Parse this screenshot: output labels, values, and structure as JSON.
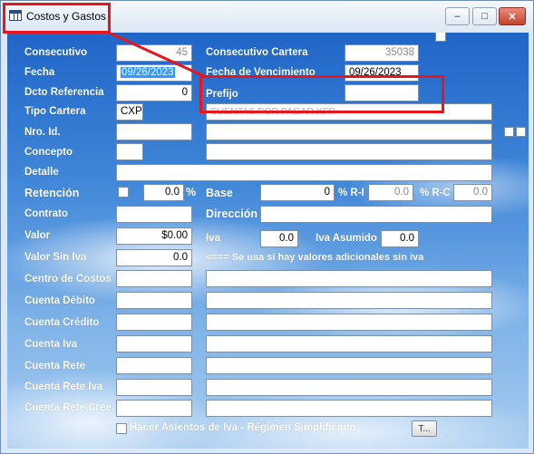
{
  "window": {
    "title": "Costos y Gastos",
    "minimize_glyph": "–",
    "maximize_glyph": "□",
    "close_glyph": "✕"
  },
  "form": {
    "consecutivo": {
      "label": "Consecutivo",
      "value": "45"
    },
    "consecutivo_cartera": {
      "label": "Consecutivo Cartera",
      "value": "35038"
    },
    "fecha": {
      "label": "Fecha",
      "value": "09/26/2023"
    },
    "fecha_vencimiento": {
      "label": "Fecha de Vencimiento",
      "value": "09/26/2023"
    },
    "dcto_referencia": {
      "label": "Dcto Referencia",
      "value": "0"
    },
    "prefijo": {
      "label": "Prefijo",
      "value": ""
    },
    "tipo_cartera": {
      "label": "Tipo Cartera",
      "value": "CXP",
      "description": "CUENTAS POR PAGAR XFP"
    },
    "nro_id": {
      "label": "Nro. Id.",
      "value": "",
      "name": ""
    },
    "concepto": {
      "label": "Concepto",
      "value": "",
      "description": ""
    },
    "detalle": {
      "label": "Detalle",
      "value": ""
    },
    "retencion": {
      "label": "Retención",
      "value": "0.0",
      "unit": "%"
    },
    "base": {
      "label": "Base",
      "value": "0"
    },
    "pct_ri": {
      "label": "% R-I",
      "value": "0.0"
    },
    "pct_rc": {
      "label": "% R-C",
      "value": "0.0"
    },
    "contrato": {
      "label": "Contrato",
      "value": ""
    },
    "direccion": {
      "label": "Dirección",
      "value": ""
    },
    "valor": {
      "label": "Valor",
      "value": "$0.00"
    },
    "iva": {
      "label": "Iva",
      "value": "0.0"
    },
    "iva_asumido": {
      "label": "Iva Asumido",
      "value": "0.0"
    },
    "valor_sin_iva": {
      "label": "Valor Sin Iva",
      "value": "0.0",
      "note": "<=== Se usa si hay valores adicionales sin iva"
    },
    "centro_costos": {
      "label": "Centro de Costos",
      "value": "",
      "description": ""
    },
    "cuenta_debito": {
      "label": "Cuenta Débito",
      "value": "",
      "description": ""
    },
    "cuenta_credito": {
      "label": "Cuenta Crédito",
      "value": "",
      "description": ""
    },
    "cuenta_iva": {
      "label": "Cuenta Iva",
      "value": "",
      "description": ""
    },
    "cuenta_rete": {
      "label": "Cuenta Rete",
      "value": "",
      "description": ""
    },
    "cuenta_rete_iva": {
      "label": "Cuenta Rete Iva",
      "value": "",
      "description": ""
    },
    "cuenta_rete_cree": {
      "label": "Cuenta Rete Cree",
      "value": "",
      "description": ""
    },
    "asientos_iva": {
      "label": "Hacer Asientos de Iva - Régimen Simplificado"
    },
    "t_button": {
      "label": "T..."
    }
  },
  "annotations": {
    "highlight_color": "#e8151c"
  }
}
